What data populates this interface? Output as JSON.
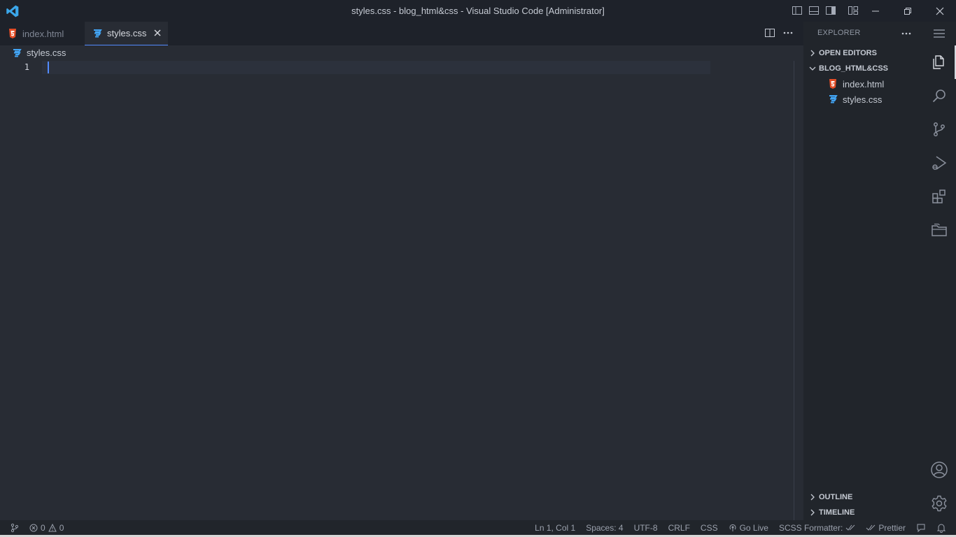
{
  "window": {
    "title": "styles.css - blog_html&css - Visual Studio Code [Administrator]",
    "icons": [
      "vscode-logo",
      "toggle-primary-sidebar-icon",
      "toggle-panel-icon",
      "toggle-secondary-sidebar-icon",
      "customize-layout-icon",
      "minimize-icon",
      "restore-icon",
      "close-icon"
    ]
  },
  "tabs": [
    {
      "label": "index.html",
      "icon": "html-file-icon",
      "active": false
    },
    {
      "label": "styles.css",
      "icon": "css-file-icon",
      "active": true
    }
  ],
  "editor": {
    "breadcrumb": "styles.css",
    "line_numbers": [
      "1"
    ],
    "content": ""
  },
  "explorer": {
    "title": "EXPLORER",
    "sections": {
      "open_editors": "OPEN EDITORS",
      "folder": "BLOG_HTML&CSS",
      "outline": "OUTLINE",
      "timeline": "TIMELINE"
    },
    "files": [
      {
        "label": "index.html",
        "icon": "html-file-icon"
      },
      {
        "label": "styles.css",
        "icon": "css-file-icon"
      }
    ]
  },
  "activity_bar": [
    "menu-icon",
    "explorer-icon",
    "search-icon",
    "source-control-icon",
    "run-debug-icon",
    "extensions-icon",
    "remote-explorer-icon",
    "accounts-icon",
    "settings-gear-icon"
  ],
  "status": {
    "errors": "0",
    "warnings": "0",
    "position": "Ln 1, Col 1",
    "spaces": "Spaces: 4",
    "encoding": "UTF-8",
    "eol": "CRLF",
    "language": "CSS",
    "go_live": "Go Live",
    "scss_formatter": "SCSS Formatter: ",
    "prettier": "Prettier"
  },
  "colors": {
    "editor_bg": "#282c34",
    "chrome_bg": "#1e222a",
    "sidebar_bg": "#21252b",
    "accent": "#528bff",
    "html_icon": "#e44d26",
    "css_icon": "#42a5f5"
  }
}
